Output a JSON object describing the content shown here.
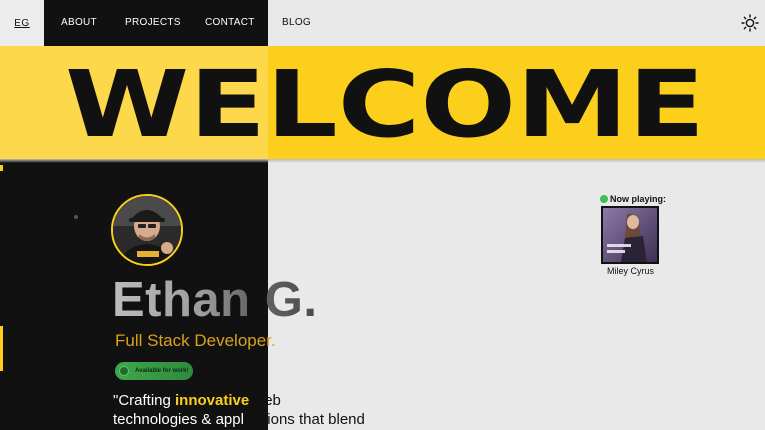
{
  "nav": {
    "logo": "EG",
    "links": [
      "ABOUT",
      "PROJECTS",
      "CONTACT",
      "BLOG"
    ]
  },
  "banner": {
    "title": "WELCOME"
  },
  "profile": {
    "name": "Ethan G.",
    "role": "Full Stack Developer.",
    "status": "Available for work!",
    "tagline_part1": "\"Crafting ",
    "tagline_highlight": "innovative",
    "tagline_part2": " web",
    "tagline_line2a": "technologies & appl",
    "tagline_line2b": "ications that blend"
  },
  "now_playing": {
    "label": "Now playing:",
    "artist": "Miley Cyrus"
  },
  "colors": {
    "accent_yellow": "#fbcf1b",
    "dark_panel": "#111111",
    "background": "#e9e9e9",
    "status_green": "#3fa84c"
  }
}
